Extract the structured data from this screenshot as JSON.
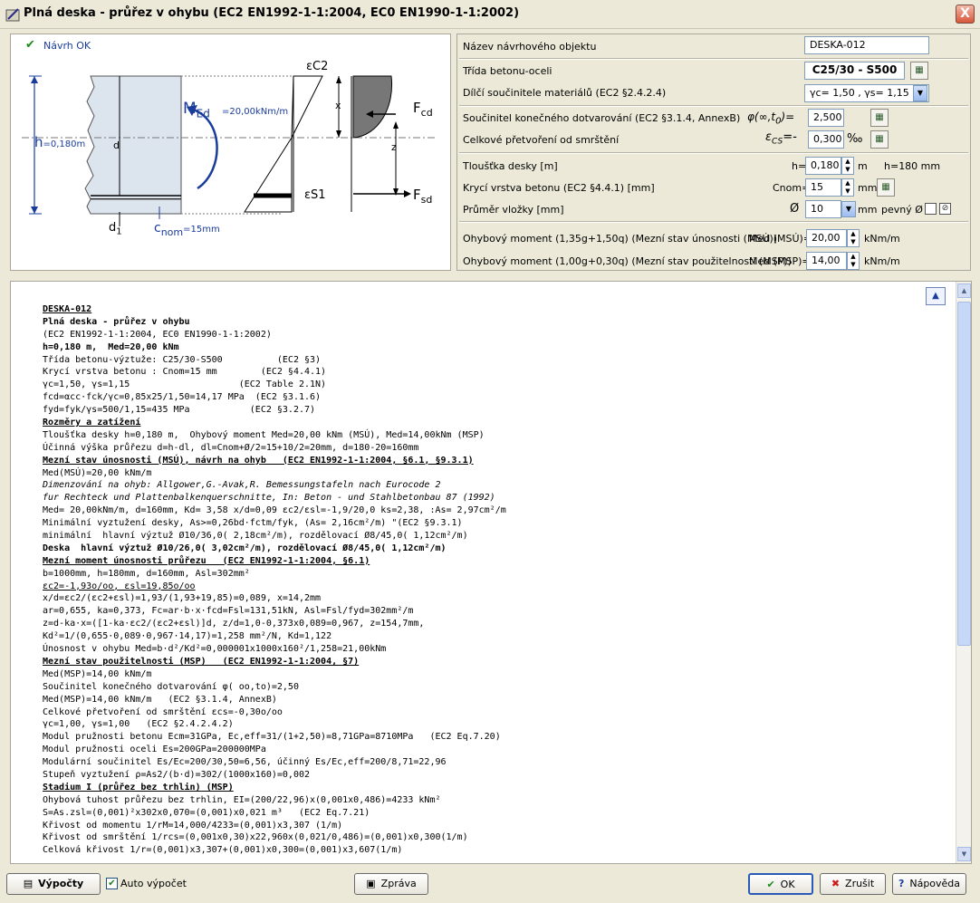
{
  "window": {
    "title": "Plná deska - průřez v ohybu (EC2 EN1992-1-1:2004, EC0 EN1990-1-1:2002)",
    "close_label": "X"
  },
  "diagram": {
    "status": "Návrh OK",
    "eps_c2": "εC2",
    "med_label": "M",
    "med_sub": "Ed",
    "med_value": "=20,00kNm/m",
    "x_label": "x",
    "z_label": "z",
    "d_label": "d",
    "fcd_label": "F",
    "fcd_sub": "cd",
    "fsd_label": "F",
    "fsd_sub": "sd",
    "eps_s1": "εS1",
    "h_label": "h",
    "h_value": "=0,180m",
    "d1_label": "d",
    "d1_sub": "1",
    "cnom_label": "c",
    "cnom_sub": "nom",
    "cnom_value": "=15mm"
  },
  "form": {
    "name_label": "Název návrhového objektu",
    "name_value": "DESKA-012",
    "class_label": "Třída betonu-oceli",
    "class_value": "C25/30 - S500",
    "factors_label": "Dílčí součinitele materiálů (EC2 §2.4.2.4)",
    "factors_value": "γc= 1,50 , γs= 1,15",
    "creep_label": "Součinitel konečného dotvarování (EC2 §3.1.4, AnnexB)",
    "creep_sym": "φ(∞,t",
    "creep_sub": "0",
    "creep_eq": ")=",
    "creep_value": "2,500",
    "shrink_label": "Celkové přetvoření od smrštění",
    "shrink_sym": "ε",
    "shrink_sub": "CS",
    "shrink_eq": "=-",
    "shrink_value": "0,300",
    "shrink_unit": "‰",
    "thick_label": "Tloušťka desky [m]",
    "thick_sym": "h=",
    "thick_value": "0,180",
    "thick_unit": "m",
    "thick_mm": "h=180 mm",
    "cover_label": "Krycí vrstva betonu (EC2 §4.4.1) [mm]",
    "cover_sym": "Cnom=",
    "cover_value": "15",
    "cover_unit": "mm",
    "diam_label": "Průměr vložky [mm]",
    "diam_sym": "Ø",
    "diam_value": "10",
    "diam_unit": "mm",
    "fixed_label": "pevný Ø",
    "med_uls_label": "Ohybový moment (1,35g+1,50q) (Mezní stav únosnosti (MSÚ))",
    "med_uls_sym": "Med (MSÚ)=",
    "med_uls_value": "20,00",
    "med_uls_unit": "kNm/m",
    "med_sls_label": "Ohybový moment (1,00g+0,30q) (Mezní stav použitelnosti (MSP))",
    "med_sls_sym": "Med (MSP)=",
    "med_sls_value": "14,00",
    "med_sls_unit": "kNm/m"
  },
  "report": {
    "lines": [
      {
        "t": "DESKA-012",
        "s": "b u"
      },
      {
        "t": "Plná deska - průřez v ohybu",
        "s": "b"
      },
      {
        "t": "(EC2 EN1992-1-1:2004, EC0 EN1990-1-1:2002)",
        "s": ""
      },
      {
        "t": "h=0,180 m,  Med=20,00 kNm",
        "s": "b"
      },
      {
        "t": "Třída betonu-výztuže: C25/30-S500          (EC2 §3)",
        "s": ""
      },
      {
        "t": "Krycí vrstva betonu : Cnom=15 mm        (EC2 §4.4.1)",
        "s": ""
      },
      {
        "t": "γc=1,50, γs=1,15                    (EC2 Table 2.1N)",
        "s": ""
      },
      {
        "t": "fcd=αcc·fck/γc=0,85x25/1,50=14,17 MPa  (EC2 §3.1.6)",
        "s": ""
      },
      {
        "t": "fyd=fyk/γs=500/1,15=435 MPa           (EC2 §3.2.7)",
        "s": ""
      },
      {
        "t": "Rozměry a zatížení",
        "s": "b u"
      },
      {
        "t": "Tloušťka desky h=0,180 m,  Ohybový moment Med=20,00 kNm (MSÚ), Med=14,00kNm (MSP)",
        "s": ""
      },
      {
        "t": "Účinná výška průřezu d=h-dl, dl=Cnom+Ø/2=15+10/2=20mm, d=180-20=160mm",
        "s": ""
      },
      {
        "t": "Mezní stav únosnosti (MSÚ), návrh na ohyb   (EC2 EN1992-1-1:2004, §6.1, §9.3.1)",
        "s": "b u"
      },
      {
        "t": "Med(MSÚ)=20,00 kNm/m",
        "s": ""
      },
      {
        "t": "Dimenzování na ohyb: Allgower,G.-Avak,R. Bemessungstafeln nach Eurocode 2",
        "s": "it"
      },
      {
        "t": "fur Rechteck und Plattenbalkenquerschnitte, In: Beton - und Stahlbetonbau 87 (1992)",
        "s": "it"
      },
      {
        "t": "Med= 20,00kNm/m, d=160mm, Kd= 3,58 x/d=0,09 εc2/εsl=-1,9/20,0 ks=2,38, :As= 2,97cm²/m",
        "s": ""
      },
      {
        "t": "Minimální vyztužení desky, As>=0,26bd·fctm/fyk, (As= 2,16cm²/m) \"(EC2 §9.3.1)",
        "s": ""
      },
      {
        "t": "minimální  hlavní výztuž Ø10/36,0( 2,18cm²/m), rozdělovací Ø8/45,0( 1,12cm²/m)",
        "s": ""
      },
      {
        "t": "Deska  hlavní výztuž Ø10/26,0( 3,02cm²/m), rozdělovací Ø8/45,0( 1,12cm²/m)",
        "s": "b"
      },
      {
        "t": "Mezní moment únosnosti průřezu   (EC2 EN1992-1-1:2004, §6.1)",
        "s": "b u"
      },
      {
        "t": "b=1000mm, h=180mm, d=160mm, Asl=302mm²",
        "s": ""
      },
      {
        "t": "εc2=-1,93o/oo, εsl=19,85o/oo",
        "s": "u"
      },
      {
        "t": "x/d=εc2/(εc2+εsl)=1,93/(1,93+19,85)=0,089, x=14,2mm",
        "s": ""
      },
      {
        "t": "ar=0,655, ka=0,373, Fc=ar·b·x·fcd=Fsl=131,51kN, Asl=Fsl/fyd=302mm²/m",
        "s": ""
      },
      {
        "t": "z=d-ka·x=([1-ka·εc2/(εc2+εsl)]d, z/d=1,0-0,373x0,089=0,967, z=154,7mm,",
        "s": ""
      },
      {
        "t": "Kd²=1/(0,655·0,089·0,967·14,17)=1,258 mm²/N, Kd=1,122",
        "s": ""
      },
      {
        "t": "Únosnost v ohybu Med=b·d²/Kd²=0,000001x1000x160²/1,258=21,00kNm",
        "s": ""
      },
      {
        "t": "Mezní stav použitelnosti (MSP)   (EC2 EN1992-1-1:2004, §7)",
        "s": "b u"
      },
      {
        "t": "Med(MSP)=14,00 kNm/m",
        "s": ""
      },
      {
        "t": "Součinitel konečného dotvarování φ( oo,to)=2,50",
        "s": ""
      },
      {
        "t": "Med(MSP)=14,00 kNm/m   (EC2 §3.1.4, AnnexB)",
        "s": ""
      },
      {
        "t": "Celkové přetvoření od smrštění εcs=-0,30o/oo",
        "s": ""
      },
      {
        "t": "γc=1,00, γs=1,00   (EC2 §2.4.2.4.2)",
        "s": ""
      },
      {
        "t": "Modul pružnosti betonu Ecm=31GPa, Ec,eff=31/(1+2,50)=8,71GPa=8710MPa   (EC2 Eq.7.20)",
        "s": ""
      },
      {
        "t": "Modul pružnosti oceli Es=200GPa=200000MPa",
        "s": ""
      },
      {
        "t": "Modulární součinitel Es/Ec=200/30,50=6,56, účinný Es/Ec,eff=200/8,71=22,96",
        "s": ""
      },
      {
        "t": "Stupeň vyztužení ρ=As2/(b·d)=302/(1000x160)=0,002",
        "s": ""
      },
      {
        "t": "Stadium I (průřez bez trhlin) (MSP)",
        "s": "b u"
      },
      {
        "t": "Ohybová tuhost průřezu bez trhlin, EI=(200/22,96)x(0,001x0,486)=4233 kNm²",
        "s": ""
      },
      {
        "t": "S=As.zsl=(0,001)²x302x0,070=(0,001)x0,021 m³   (EC2 Eq.7.21)",
        "s": ""
      },
      {
        "t": "Křivost od momentu 1/rM=14,000/4233=(0,001)x3,307 (1/m)",
        "s": ""
      },
      {
        "t": "Křivost od smrštění 1/rcs=(0,001x0,30)x22,960x(0,021/0,486)=(0,001)x0,300(1/m)",
        "s": ""
      },
      {
        "t": "Celková křivost 1/r=(0,001)x3,307+(0,001)x0,300=(0,001)x3,607(1/m)",
        "s": ""
      }
    ]
  },
  "buttons": {
    "calc": "Výpočty",
    "auto": "Auto výpočet",
    "report": "Zpráva",
    "ok": "OK",
    "cancel": "Zrušit",
    "help": "Nápověda"
  }
}
